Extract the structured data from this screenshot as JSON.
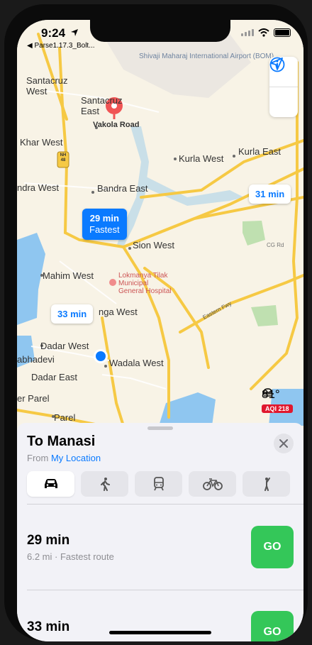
{
  "status_bar": {
    "time": "9:24",
    "back_app": "◀ Parse1.17.3_Bolt..."
  },
  "map": {
    "labels": {
      "santacruz_west": "Santacruz West",
      "santacruz_east": "Santacruz East",
      "vakola_road": "Vakola Road",
      "airport": "Shivaji Maharaj International Airport (BOM)",
      "khar_west": "Khar West",
      "kurla_west": "Kurla West",
      "kurla_east": "Kurla East",
      "bandra_west": "ndra West",
      "bandra_east": "Bandra East",
      "sion_west": "Sion West",
      "mahim_west": "Mahim West",
      "hospital": "Lokmanya Tilak Municipal General Hospital",
      "matunga_west": "nga West",
      "dadar_west": "Dadar West",
      "prabhadevi": "abhadevi",
      "wadala_west": "Wadala West",
      "dadar_east": "Dadar East",
      "lower_parel": "er Parel",
      "parel": "Parel",
      "cg_rd": "CG Rd",
      "eastern_fwy": "Eastern Fwy",
      "nh48": "NH 48"
    },
    "route_bubbles": {
      "fastest_time": "29 min",
      "fastest_label": "Fastest",
      "alt1": "31 min",
      "alt2": "33 min"
    },
    "weather": {
      "temperature": "81°",
      "aqi": "AQI 218"
    }
  },
  "sheet": {
    "destination": "To Manasi",
    "from_prefix": "From",
    "from_location": "My Location",
    "modes": [
      "drive",
      "walk",
      "transit",
      "cycle",
      "ride"
    ],
    "active_mode": "drive",
    "routes": [
      {
        "time": "29 min",
        "info": "6.2 mi · Fastest route",
        "go": "GO"
      },
      {
        "time": "33 min",
        "info": "",
        "go": "GO"
      }
    ]
  },
  "colors": {
    "accent": "#0a7aff",
    "go": "#34c759",
    "aqi": "#e0182e",
    "road": "#f6c944",
    "water": "#8fc6f0"
  }
}
